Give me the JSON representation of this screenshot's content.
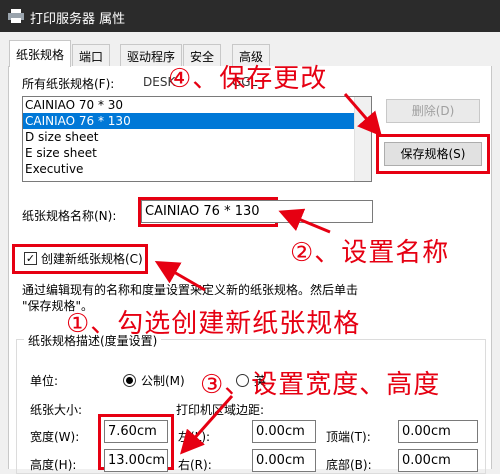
{
  "window": {
    "title": "打印服务器 属性"
  },
  "tabs": [
    {
      "label": "纸张规格",
      "active": true
    },
    {
      "label": "端口",
      "active": false
    },
    {
      "label": "驱动程序",
      "active": false
    },
    {
      "label": "安全",
      "active": false
    },
    {
      "label": "高级",
      "active": false
    }
  ],
  "forms_on_label": "所有纸张规格(F):",
  "server_name_partial": "DESK",
  "server_name_tail": "GGL",
  "forms_list": [
    "CAINIAO 70 * 30",
    "CAINIAO 76 * 130",
    "D size sheet",
    "E size sheet",
    "Executive"
  ],
  "selected_form_index": 1,
  "delete_button": "删除(D)",
  "save_button": "保存规格(S)",
  "form_name_label": "纸张规格名称(N):",
  "form_name_value": "CAINIAO 76 * 130",
  "create_checkbox_label": "创建新纸张规格(C)",
  "create_checkbox_checked": true,
  "description_line1": "通过编辑现有的名称和度量设置来定义新的纸张规格。然后单击",
  "description_line2": "\"保存规格\"。",
  "group_label": "纸张规格描述(度量设置)",
  "units_label": "单位:",
  "unit_metric": "公制(M)",
  "unit_english_partial": "英",
  "paper_size_label": "纸张大小:",
  "margins_label": "打印机区域边距:",
  "width_label": "宽度(W):",
  "width_value": "7.60cm",
  "height_label": "高度(H):",
  "height_value": "13.00cm",
  "left_label": "左(L):",
  "left_value": "0.00cm",
  "right_label": "右(R):",
  "right_value": "0.00cm",
  "top_label": "顶端(T):",
  "top_value": "0.00cm",
  "bottom_label": "底部(B):",
  "bottom_value": "0.00cm",
  "annotations": {
    "step4": "④、保存更改",
    "step2": "②、设置名称",
    "step1": "①、勾选创建新纸张规格",
    "step3": "③、设置宽度、高度"
  },
  "colors": {
    "annotation": "#e60012",
    "selection": "#0078d7",
    "titlebar": "#2b2b2b"
  }
}
